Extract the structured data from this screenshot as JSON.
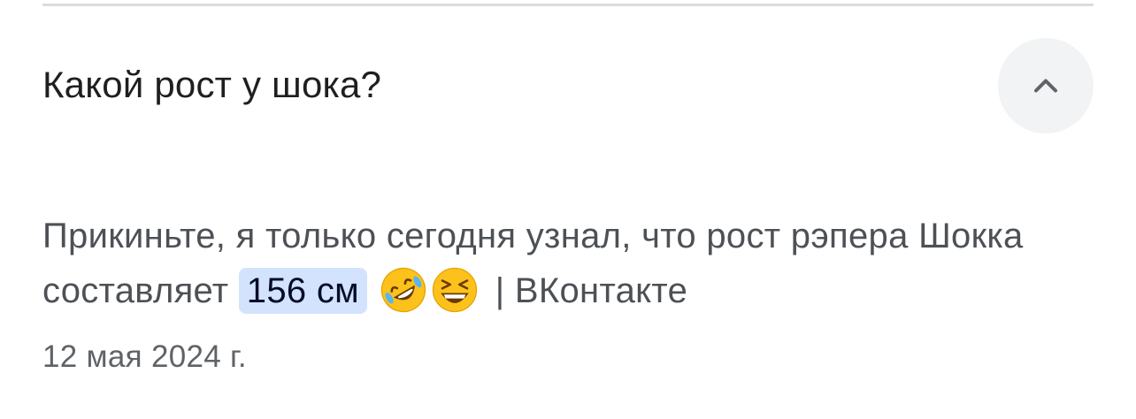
{
  "faq": {
    "question": "Какой рост у шока?",
    "answer": {
      "text_before": "Прикиньте, я только сегодня узнал, что рост рэпера Шокка составляет ",
      "highlight": "156 см",
      "emojis": [
        "rolling-on-floor-laughing-emoji",
        "grinning-squinting-face-emoji"
      ],
      "separator": "|",
      "source": "ВКонтакте"
    },
    "date": "12 мая 2024 г.",
    "toggle_icon": "chevron-up-icon"
  },
  "colors": {
    "highlight_bg": "#d3e3fd",
    "toggle_bg": "#f1f3f4",
    "question_text": "#1f1f1f",
    "answer_text": "#4d5156",
    "date_text": "#5f6368"
  }
}
